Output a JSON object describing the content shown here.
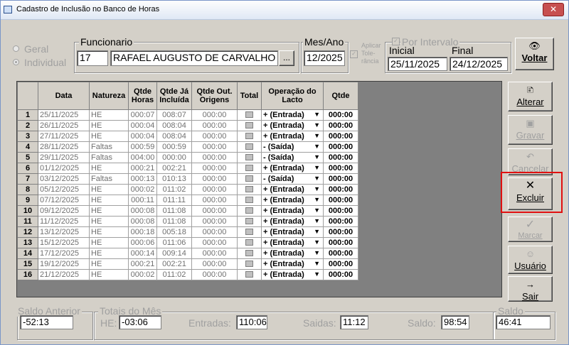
{
  "window": {
    "title": "Cadastro de Inclusão no Banco de Horas",
    "close": "✕"
  },
  "filters": {
    "radio_geral": "Geral",
    "radio_individual": "Individual",
    "funcionario_legend": "Funcionario",
    "funcionario_code": "17",
    "funcionario_name": "RAFAEL AUGUSTO DE CARVALHO",
    "lookup_btn": "...",
    "mesano_legend": "Mes/Ano",
    "mesano_value": "12/2025",
    "aplicar_line1": "Aplicar",
    "aplicar_line2": "Tole-",
    "aplicar_line3": "rância",
    "intervalo_legend": "Por Intervalo",
    "inicial_label": "Inicial",
    "final_label": "Final",
    "inicial_value": "25/11/2025",
    "final_value": "24/12/2025"
  },
  "buttons": {
    "voltar": "Voltar",
    "alterar": "Alterar",
    "gravar": "Gravar",
    "cancelar": "Cancelar",
    "excluir": "Excluir",
    "marcar": "Marcar",
    "usuario": "Usuário",
    "sair": "Sair"
  },
  "grid": {
    "headers": [
      "",
      "Data",
      "Natureza",
      "Qtde Horas",
      "Qtde Já Incluída",
      "Qtde Out. Origens",
      "Total",
      "Operação do Lacto",
      "Qtde"
    ],
    "rows": [
      {
        "n": "1",
        "data": "25/11/2025",
        "nat": "HE",
        "qh": "000:07",
        "qi": "008:07",
        "qo": "000:00",
        "op": "+ (Entrada)",
        "q": "000:00"
      },
      {
        "n": "2",
        "data": "26/11/2025",
        "nat": "HE",
        "qh": "000:04",
        "qi": "008:04",
        "qo": "000:00",
        "op": "+ (Entrada)",
        "q": "000:00"
      },
      {
        "n": "3",
        "data": "27/11/2025",
        "nat": "HE",
        "qh": "000:04",
        "qi": "008:04",
        "qo": "000:00",
        "op": "+ (Entrada)",
        "q": "000:00"
      },
      {
        "n": "4",
        "data": "28/11/2025",
        "nat": "Faltas",
        "qh": "000:59",
        "qi": "000:59",
        "qo": "000:00",
        "op": "- (Saída)",
        "q": "000:00"
      },
      {
        "n": "5",
        "data": "29/11/2025",
        "nat": "Faltas",
        "qh": "004:00",
        "qi": "000:00",
        "qo": "000:00",
        "op": "- (Saída)",
        "q": "000:00"
      },
      {
        "n": "6",
        "data": "01/12/2025",
        "nat": "HE",
        "qh": "000:21",
        "qi": "002:21",
        "qo": "000:00",
        "op": "+ (Entrada)",
        "q": "000:00"
      },
      {
        "n": "7",
        "data": "03/12/2025",
        "nat": "Faltas",
        "qh": "000:13",
        "qi": "010:13",
        "qo": "000:00",
        "op": "- (Saída)",
        "q": "000:00"
      },
      {
        "n": "8",
        "data": "05/12/2025",
        "nat": "HE",
        "qh": "000:02",
        "qi": "011:02",
        "qo": "000:00",
        "op": "+ (Entrada)",
        "q": "000:00"
      },
      {
        "n": "9",
        "data": "07/12/2025",
        "nat": "HE",
        "qh": "000:11",
        "qi": "011:11",
        "qo": "000:00",
        "op": "+ (Entrada)",
        "q": "000:00"
      },
      {
        "n": "10",
        "data": "09/12/2025",
        "nat": "HE",
        "qh": "000:08",
        "qi": "011:08",
        "qo": "000:00",
        "op": "+ (Entrada)",
        "q": "000:00"
      },
      {
        "n": "11",
        "data": "11/12/2025",
        "nat": "HE",
        "qh": "000:08",
        "qi": "011:08",
        "qo": "000:00",
        "op": "+ (Entrada)",
        "q": "000:00"
      },
      {
        "n": "12",
        "data": "13/12/2025",
        "nat": "HE",
        "qh": "000:18",
        "qi": "005:18",
        "qo": "000:00",
        "op": "+ (Entrada)",
        "q": "000:00"
      },
      {
        "n": "13",
        "data": "15/12/2025",
        "nat": "HE",
        "qh": "000:06",
        "qi": "011:06",
        "qo": "000:00",
        "op": "+ (Entrada)",
        "q": "000:00"
      },
      {
        "n": "14",
        "data": "17/12/2025",
        "nat": "HE",
        "qh": "000:14",
        "qi": "009:14",
        "qo": "000:00",
        "op": "+ (Entrada)",
        "q": "000:00"
      },
      {
        "n": "15",
        "data": "19/12/2025",
        "nat": "HE",
        "qh": "000:21",
        "qi": "002:21",
        "qo": "000:00",
        "op": "+ (Entrada)",
        "q": "000:00"
      },
      {
        "n": "16",
        "data": "21/12/2025",
        "nat": "HE",
        "qh": "000:02",
        "qi": "011:02",
        "qo": "000:00",
        "op": "+ (Entrada)",
        "q": "000:00"
      }
    ]
  },
  "footer": {
    "saldo_anterior_legend": "Saldo Anterior",
    "saldo_anterior_value": "-52:13",
    "totais_legend": "Totais do Mês",
    "he_label": "HE:",
    "he_value": "-03:06",
    "entradas_label": "Entradas:",
    "entradas_value": "110:06",
    "saidas_label": "Saidas:",
    "saidas_value": "11:12",
    "saldo_mid_label": "Saldo:",
    "saldo_mid_value": "98:54",
    "saldo_legend": "Saldo",
    "saldo_value": "46:41"
  },
  "icons": {
    "voltar": "binoculars-icon",
    "alterar": "edit-icon",
    "gravar": "save-icon",
    "cancelar": "undo-icon",
    "excluir": "x-icon",
    "marcar": "check-icon",
    "usuario": "user-icon",
    "sair": "exit-icon"
  },
  "colors": {
    "highlight": "#e01010",
    "face": "#d4d0c8"
  }
}
